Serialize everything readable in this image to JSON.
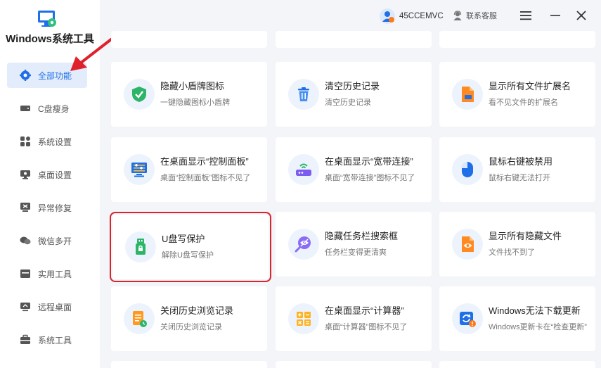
{
  "app": {
    "title": "Windows系统工具"
  },
  "sidebar": {
    "items": [
      {
        "label": "全部功能",
        "icon": "gear-icon",
        "active": true
      },
      {
        "label": "C盘瘦身",
        "icon": "disk-icon"
      },
      {
        "label": "系统设置",
        "icon": "grid-icon"
      },
      {
        "label": "桌面设置",
        "icon": "monitor-icon"
      },
      {
        "label": "异常修复",
        "icon": "repair-icon"
      },
      {
        "label": "微信多开",
        "icon": "chat-icon"
      },
      {
        "label": "实用工具",
        "icon": "toolbox-icon"
      },
      {
        "label": "远程桌面",
        "icon": "remote-desktop-icon"
      },
      {
        "label": "系统工具",
        "icon": "briefcase-icon"
      }
    ]
  },
  "header": {
    "username": "45CCEMVC",
    "service_label": "联系客服"
  },
  "cards": [
    {
      "title": "隐藏小盾牌图标",
      "desc": "一键隐藏图标小盾牌",
      "icon": "shield-icon"
    },
    {
      "title": "清空历史记录",
      "desc": "清空历史记录",
      "icon": "trash-icon"
    },
    {
      "title": "显示所有文件扩展名",
      "desc": "看不见文件的扩展名",
      "icon": "file-extension-icon"
    },
    {
      "title": "在桌面显示“控制面板”",
      "desc": "桌面“控制面板”图标不见了",
      "icon": "control-panel-icon"
    },
    {
      "title": "在桌面显示“宽带连接”",
      "desc": "桌面“宽带连接”图标不见了",
      "icon": "router-icon"
    },
    {
      "title": "鼠标右键被禁用",
      "desc": "鼠标右键无法打开",
      "icon": "mouse-icon"
    },
    {
      "title": "U盘写保护",
      "desc": "解除U盘写保护",
      "icon": "usb-lock-icon",
      "highlighted": true
    },
    {
      "title": "隐藏任务栏搜索框",
      "desc": "任务栏变得更清爽",
      "icon": "hidden-search-icon"
    },
    {
      "title": "显示所有隐藏文件",
      "desc": "文件找不到了",
      "icon": "eye-file-icon"
    },
    {
      "title": "关闭历史浏览记录",
      "desc": "关闭历史浏览记录",
      "icon": "history-doc-icon"
    },
    {
      "title": "在桌面显示“计算器”",
      "desc": "桌面“计算器”图标不见了",
      "icon": "calculator-icon"
    },
    {
      "title": "Windows无法下载更新",
      "desc": "Windows更新卡在“检查更新”",
      "icon": "update-icon"
    }
  ],
  "colors": {
    "accent": "#1e6fe8",
    "highlight": "#d9232d",
    "background": "#f3f5f9"
  }
}
